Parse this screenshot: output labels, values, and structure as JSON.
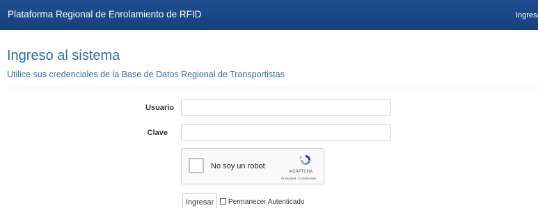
{
  "navbar": {
    "brand": "Plataforma Regional de Enrolamiento de RFID",
    "login_link": "Ingresa"
  },
  "page": {
    "title": "Ingreso al sistema",
    "subtitle": "Utilice sus credenciales de la Base de Datos Regional de Transportistas"
  },
  "form": {
    "username_label": "Usuario",
    "username_value": "",
    "password_label": "Clave",
    "password_value": "",
    "captcha": {
      "label": "No soy un robot",
      "brand": "reCAPTCHA",
      "links": "Privacidad - Condiciones"
    },
    "submit_label": "Ingresar",
    "remember_label": "Permanecer Autenticado"
  },
  "colors": {
    "navbar": "#1f4f91",
    "heading": "#2d6ba5"
  }
}
